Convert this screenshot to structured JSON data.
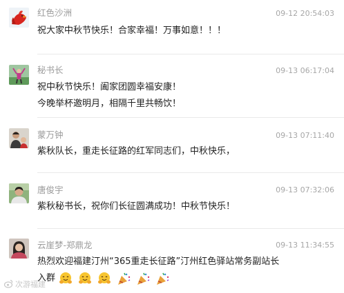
{
  "comments": [
    {
      "avatar": "red-rooster-avatar",
      "name": "红色沙洲",
      "time": "09-12 20:54:03",
      "lines": [
        "祝大家中秋节快乐！合家幸福！万事如意！！！"
      ]
    },
    {
      "avatar": "person-arms-raised-avatar",
      "name": "秘书长",
      "time": "09-13 06:17:04",
      "lines": [
        "祝中秋节快乐！阖家团圆幸福安康！",
        "今晚举杯邀明月，相隔千里共畅饮！"
      ]
    },
    {
      "avatar": "two-people-avatar",
      "name": "蒙万钟",
      "time": "09-13 07:11:40",
      "lines": [
        "紫秋队长，重走长征路的红军同志们，中秋快乐，"
      ]
    },
    {
      "avatar": "man-portrait-avatar",
      "name": "唐俊宇",
      "time": "09-13 07:32:06",
      "lines": [
        "紫秋秘书长，祝你们长征圆满成功！中秋节快乐！"
      ]
    },
    {
      "avatar": "woman-portrait-avatar",
      "name": "云崖梦-郑鼎龙",
      "time": "09-13 11:34:55",
      "lines": [
        "热烈欢迎福建汀州“365重走长征路”汀州红色驿站常务副站长",
        "入群"
      ],
      "emojis": [
        "hug-face-emoji",
        "hug-face-emoji",
        "hug-face-emoji",
        "party-popper-emoji",
        "party-popper-emoji",
        "party-popper-emoji"
      ]
    }
  ],
  "watermark": "次游福建"
}
